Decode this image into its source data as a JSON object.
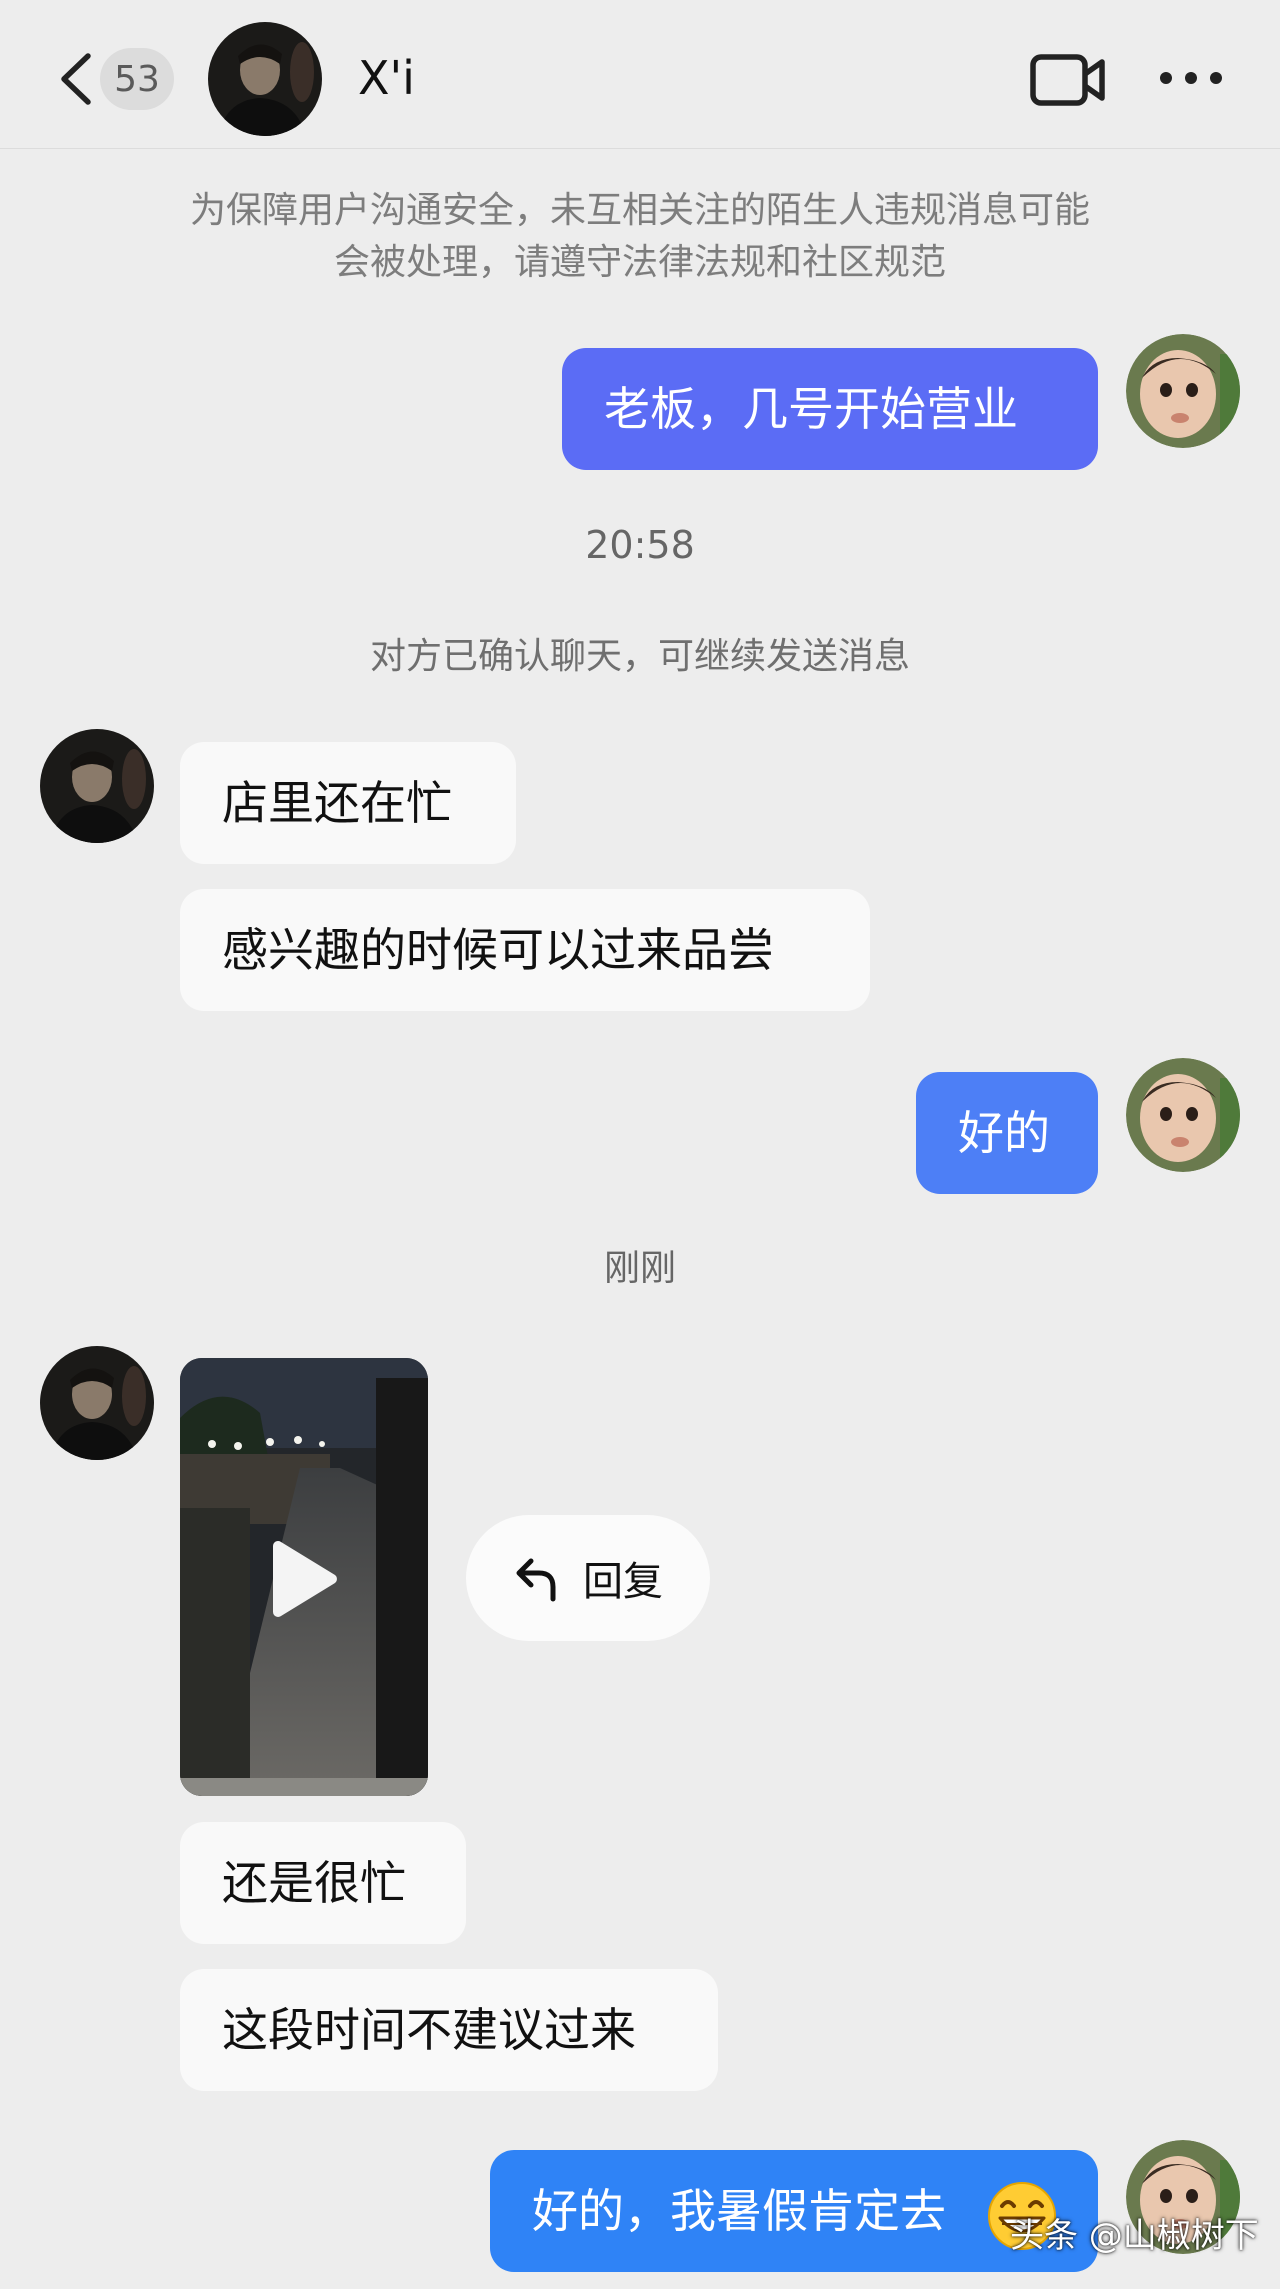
{
  "header": {
    "unread_count": "53",
    "contact_name": "X'i"
  },
  "notice": {
    "line1": "为保障用户沟通安全，未互相关注的陌生人违规消息可能",
    "line2": "会被处理，请遵守法律法规和社区规范"
  },
  "messages": {
    "m1": "老板，几号开始营业",
    "time1": "20:58",
    "confirm": "对方已确认聊天，可继续发送消息",
    "m2": "店里还在忙",
    "m3": "感兴趣的时候可以过来品尝",
    "m4": "好的",
    "time2": "刚刚",
    "reply_label": "回复",
    "m5": "还是很忙",
    "m6": "这段时间不建议过来",
    "m7": "好的，我暑假肯定去"
  },
  "watermark": "头条 @山椒树下",
  "colors": {
    "background": "#ededed",
    "outgoing_bubble": "#5b6cf5",
    "outgoing_bubble_alt": "#4d7ff6",
    "incoming_bubble": "#f9f9f9",
    "system_text": "#7d7d7d"
  }
}
